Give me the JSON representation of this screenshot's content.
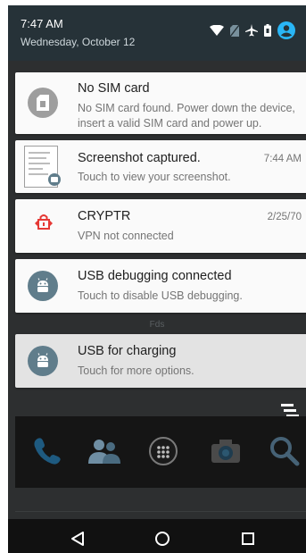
{
  "status_bar": {
    "time": "7:47 AM",
    "date": "Wednesday, October 12",
    "icons": [
      "wifi-icon",
      "no-sim-icon",
      "airplane-icon",
      "battery-icon",
      "account-icon"
    ],
    "accent_color": "#29b6f6"
  },
  "notifications": [
    {
      "title": "No SIM card",
      "body_line1": "No SIM card found. Power down the device,",
      "body_line2": "insert a valid SIM card and power up.",
      "icon": "sim-card-icon"
    },
    {
      "title": "Screenshot captured.",
      "body": "Touch to view your screenshot.",
      "time": "7:44 AM",
      "icon": "screenshot-thumbnail"
    },
    {
      "title": "CRYPTR",
      "body": "VPN not connected",
      "time": "2/25/70",
      "icon": "vpn-lock-icon",
      "icon_color": "#e53935"
    },
    {
      "title": "USB debugging connected",
      "body": "Touch to disable USB debugging.",
      "icon": "android-icon"
    },
    {
      "title": "USB for charging",
      "body": "Touch for more options.",
      "icon": "android-icon"
    }
  ],
  "divider_label": "Fds",
  "dock": [
    "phone-icon",
    "contacts-icon",
    "app-drawer-icon",
    "camera-icon",
    "search-icon"
  ],
  "nav": [
    "back-icon",
    "home-icon",
    "recents-icon"
  ]
}
